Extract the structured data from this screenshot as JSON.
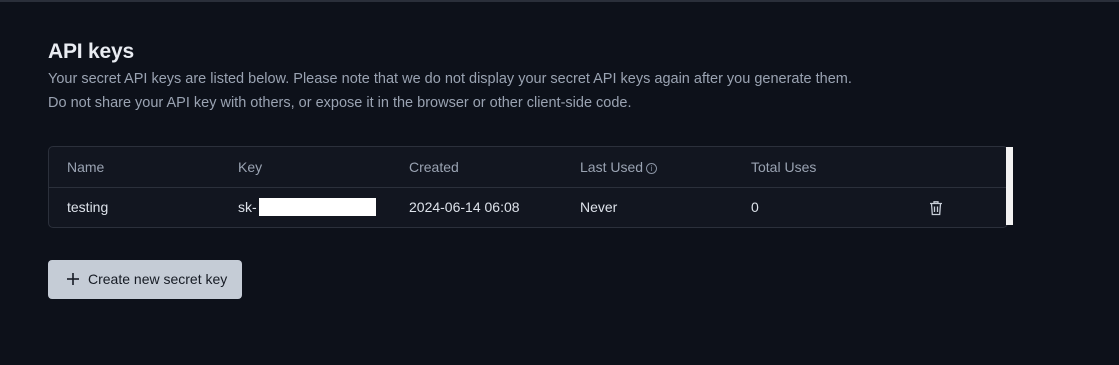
{
  "header": {
    "title": "API keys",
    "description_line1": "Your secret API keys are listed below. Please note that we do not display your secret API keys again after you generate them.",
    "description_line2": "Do not share your API key with others, or expose it in the browser or other client-side code."
  },
  "table": {
    "columns": [
      "Name",
      "Key",
      "Created",
      "Last Used",
      "Total Uses"
    ],
    "rows": [
      {
        "name": "testing",
        "key_prefix": "sk-",
        "created": "2024-06-14 06:08",
        "last_used": "Never",
        "total_uses": "0"
      }
    ]
  },
  "icons": {
    "info": "info-icon",
    "delete": "trash-icon",
    "add": "plus-icon"
  },
  "actions": {
    "create_label": "Create new secret key"
  },
  "colors": {
    "background": "#0d111a",
    "table_bg": "#121620",
    "button_bg": "#c5ccd6"
  }
}
